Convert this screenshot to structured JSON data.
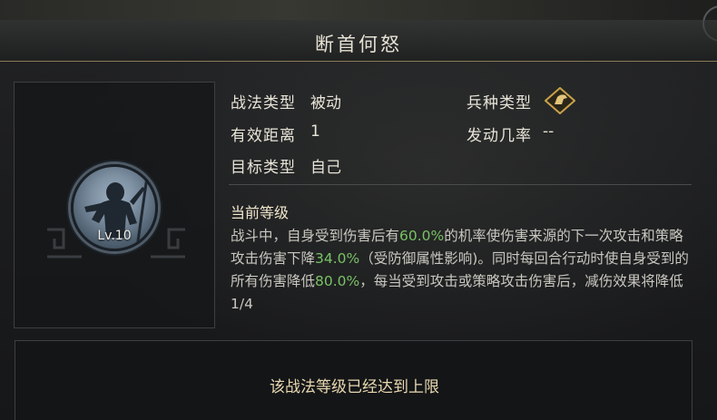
{
  "title": "断首何怒",
  "level": "Lv.10",
  "info": {
    "tactic_type_label": "战法类型",
    "tactic_type_value": "被动",
    "range_label": "有效距离",
    "range_value": "1",
    "target_label": "目标类型",
    "target_value": "自己",
    "troop_type_label": "兵种类型",
    "trigger_rate_label": "发动几率",
    "trigger_rate_value": "--"
  },
  "current_level_title": "当前等级",
  "description": {
    "p1": "战斗中，自身受到伤害后有",
    "h1": "60.0%",
    "p2": "的机率使伤害来源的下一次攻击和策略攻击伤害下降",
    "h2": "34.0%",
    "p3": "（受防御属性影响)。同时每回合行动时使自身受到的所有伤害降低",
    "h3": "80.0%",
    "p4": "，每当受到攻击或策略攻击伤害后，减伤效果将降低1/4"
  },
  "max_level_message": "该战法等级已经达到上限",
  "icons": {
    "troop_type": "horse-head-icon",
    "portrait": "warrior-portrait-icon",
    "corner": "corner-ornament-icon"
  },
  "colors": {
    "highlight": "#79c265",
    "text": "#e8e4d8",
    "accent": "#c8a24a"
  }
}
